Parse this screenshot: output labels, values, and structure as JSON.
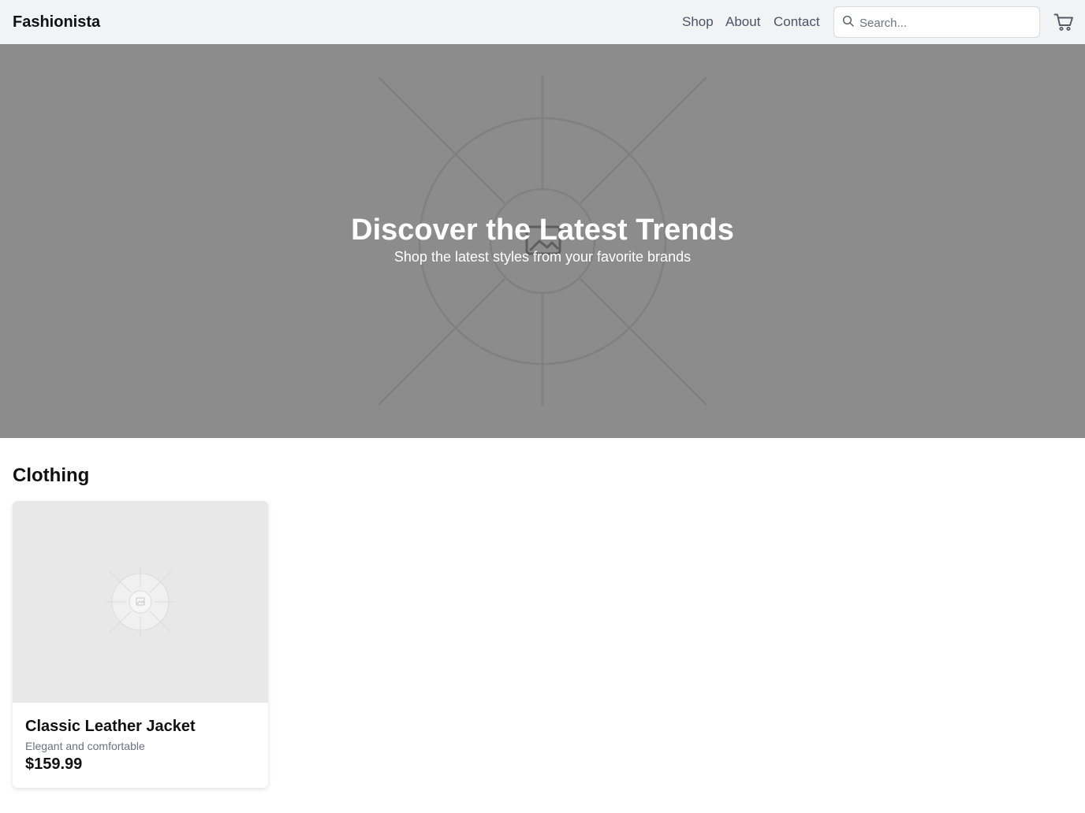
{
  "header": {
    "brand": "Fashionista",
    "nav": {
      "shop": "Shop",
      "about": "About",
      "contact": "Contact"
    },
    "search": {
      "placeholder": "Search...",
      "value": ""
    },
    "icons": [
      "search-icon",
      "cart-icon"
    ]
  },
  "hero": {
    "title": "Discover the Latest Trends",
    "subtitle": "Shop the latest styles from your favorite brands",
    "background_color": "#8c8c8c",
    "image": "placeholder-image-icon"
  },
  "section": {
    "title": "Clothing"
  },
  "products": [
    {
      "name": "Classic Leather Jacket",
      "description": "Elegant and comfortable",
      "price": "$159.99",
      "image": "placeholder-image-icon"
    }
  ],
  "colors": {
    "header_bg": "#f1f3f5",
    "text": "#111111",
    "muted_text": "#6b7280",
    "nav_text": "#4b5563"
  }
}
